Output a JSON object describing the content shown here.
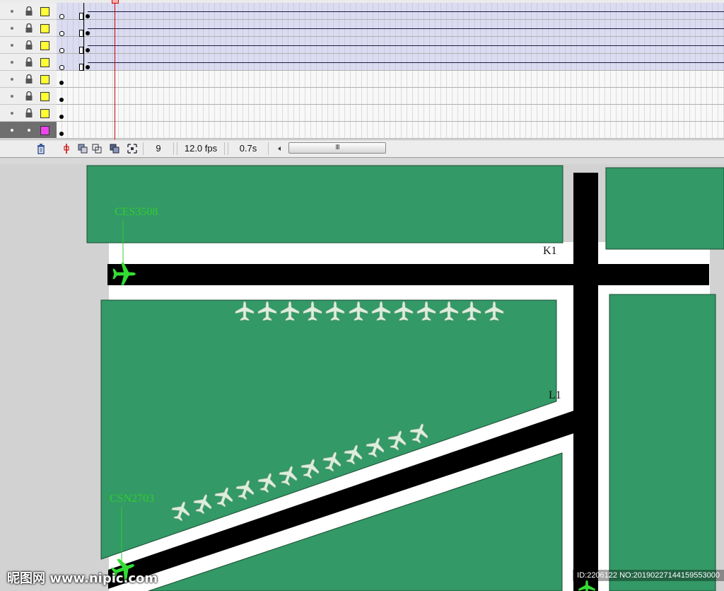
{
  "timeline": {
    "layers": [
      {
        "type": "tween",
        "selected": false
      },
      {
        "type": "tween",
        "selected": false
      },
      {
        "type": "tween",
        "selected": false
      },
      {
        "type": "tween",
        "selected": false
      },
      {
        "type": "static",
        "selected": false
      },
      {
        "type": "static",
        "selected": false
      },
      {
        "type": "static",
        "selected": false
      },
      {
        "type": "static",
        "selected": true
      }
    ],
    "status": {
      "current_frame": "9",
      "frame_rate": "12.0 fps",
      "elapsed_time": "0.7s",
      "scroll_grip": "III"
    },
    "colors": {
      "swatch_default": "#ffff33",
      "swatch_selected": "#ee44ee",
      "playhead": "#cc0000"
    }
  },
  "stage": {
    "labels": {
      "taxiway_k1": "K1",
      "taxiway_l1": "L1",
      "flight_top": "CES3508",
      "flight_bottom": "CSN2703"
    },
    "colors": {
      "grass": "#339966",
      "runway": "#000000",
      "pavement": "#ffffff",
      "flight_label": "#33cc33",
      "plane_active": "#33dd33",
      "plane_parked": "#ddeedd"
    }
  },
  "watermark": {
    "left": "昵图网 www.nipic.com",
    "right": "ID:2206122 NO:20190227144159553000"
  }
}
